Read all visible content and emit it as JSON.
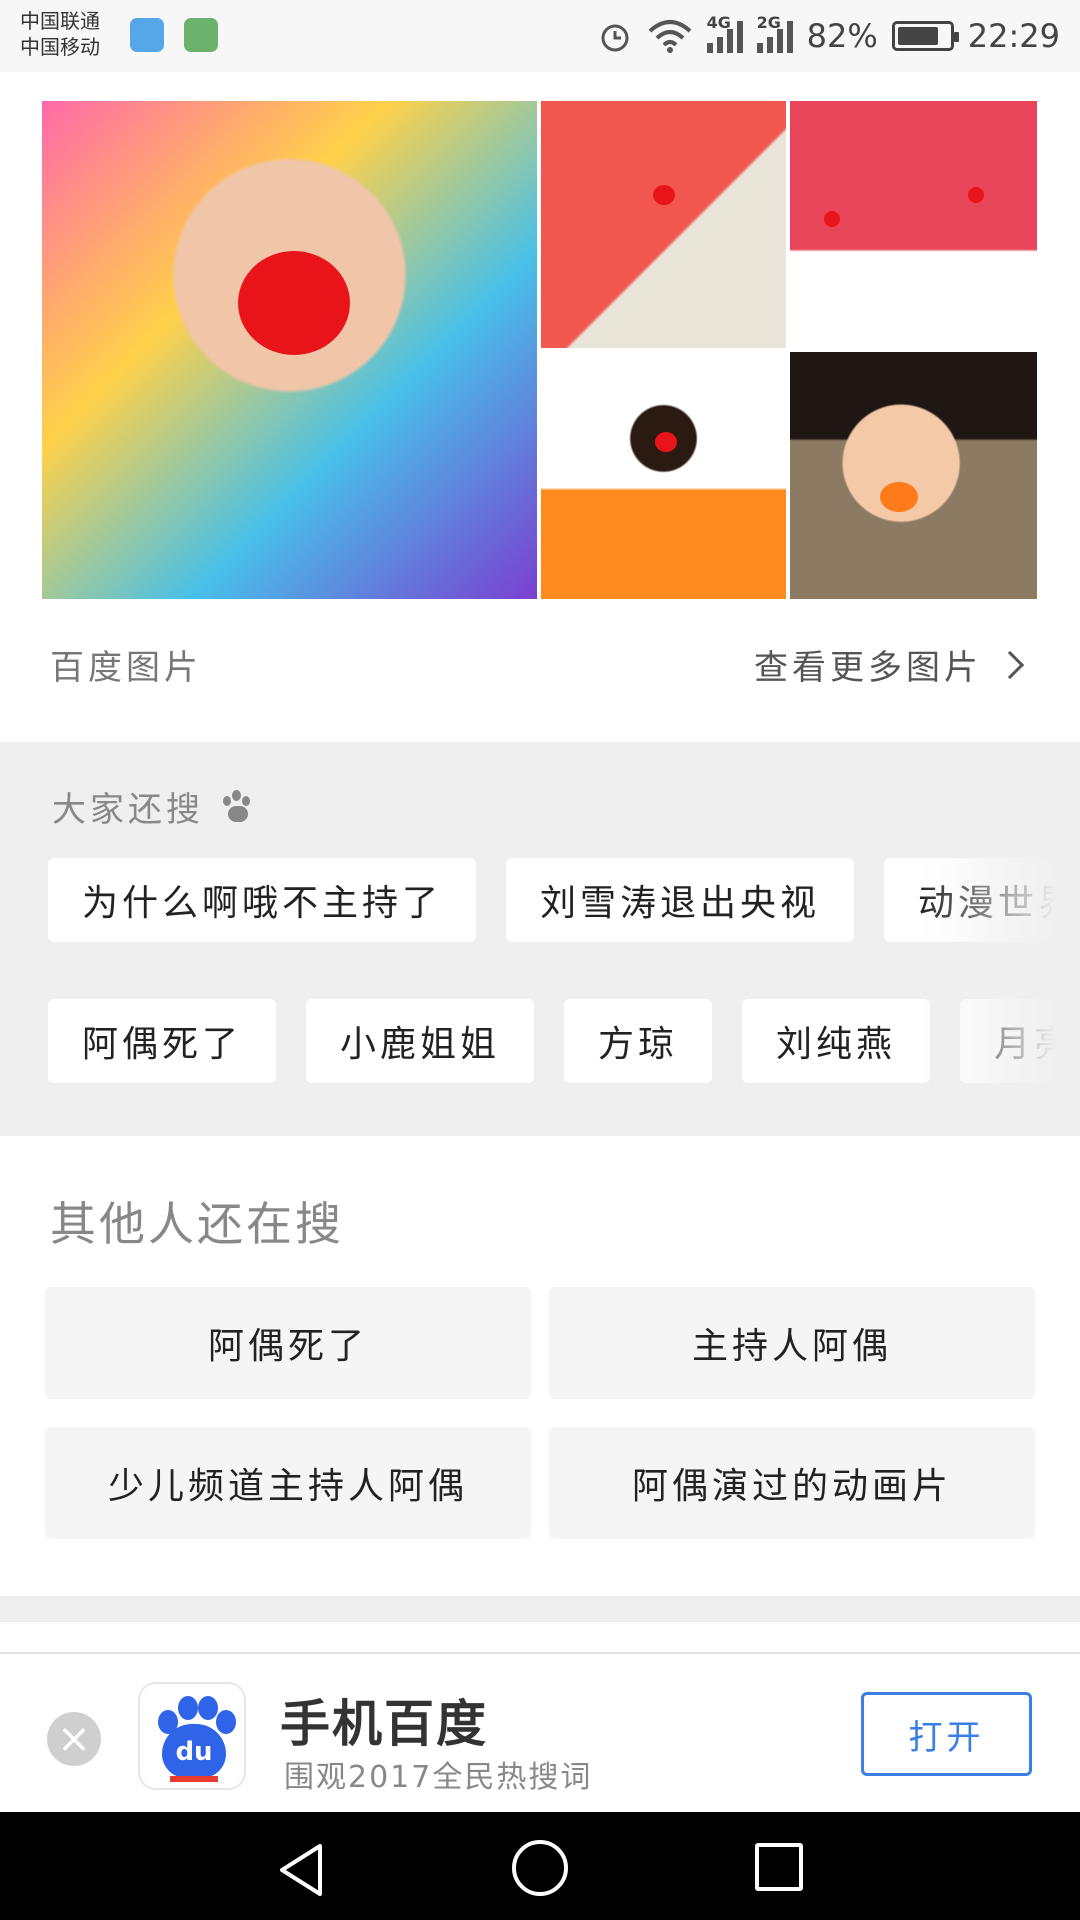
{
  "status_bar": {
    "carrier_1": "中国联通",
    "carrier_2": "中国移动",
    "signal_1_label": "4G",
    "signal_2_label": "2G",
    "battery_text": "82%",
    "battery_level": 0.82,
    "time": "22:29",
    "icons": [
      "alarm-icon",
      "wifi-icon",
      "signal-icon",
      "battery-icon"
    ]
  },
  "images": {
    "source_label": "百度图片",
    "more_label": "查看更多图片"
  },
  "related": {
    "title": "大家还搜",
    "row1": [
      "为什么啊哦不主持了",
      "刘雪涛退出央视",
      "动漫世界"
    ],
    "row2": [
      "阿偶死了",
      "小鹿姐姐",
      "方琼",
      "刘纯燕",
      "月亮"
    ]
  },
  "others": {
    "title": "其他人还在搜",
    "items": [
      "阿偶死了",
      "主持人阿偶",
      "少儿频道主持人阿偶",
      "阿偶演过的动画片"
    ]
  },
  "app_banner": {
    "logo_text": "du",
    "name": "手机百度",
    "subtitle": "围观2017全民热搜词",
    "open_label": "打开",
    "close_glyph": "×",
    "accent_color": "#3a7ee6"
  }
}
